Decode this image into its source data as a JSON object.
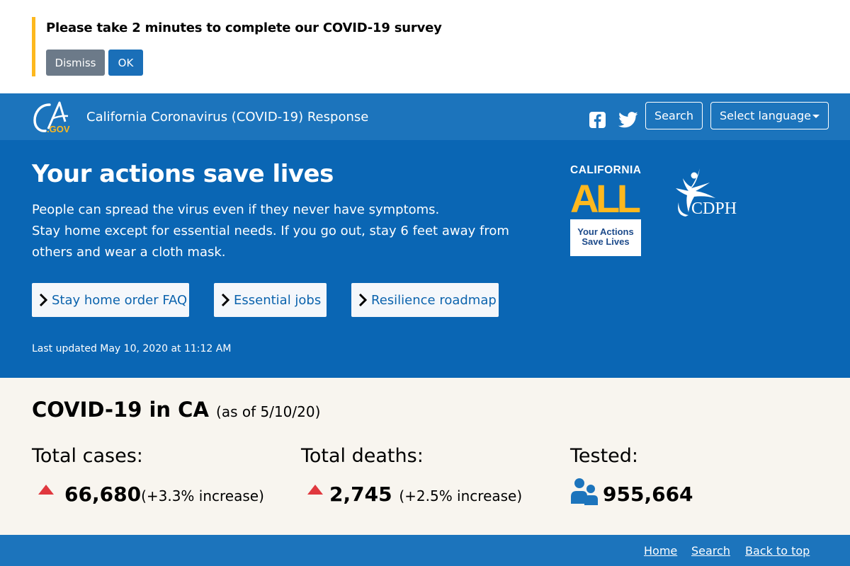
{
  "survey": {
    "message": "Please take 2 minutes to complete our COVID-19 survey",
    "dismiss_label": "Dismiss",
    "ok_label": "OK"
  },
  "header": {
    "logo_text": "CA.GOV",
    "title": "California Coronavirus (COVID-19) Response",
    "search_label": "Search",
    "language_label": "Select language",
    "icons": [
      "facebook-icon",
      "twitter-icon"
    ]
  },
  "hero": {
    "title": "Your actions save lives",
    "line1": "People can spread the virus even if they never have symptoms.",
    "line2": "Stay home except for essential needs. If you go out, stay 6 feet away from others and wear a cloth mask.",
    "links": [
      {
        "label": "Stay home order FAQ"
      },
      {
        "label": "Essential jobs"
      },
      {
        "label": "Resilience roadmap"
      }
    ],
    "updated": "Last updated May 10, 2020 at 11:12 AM",
    "badge": {
      "top": "CALIFORNIA",
      "big": "ALL",
      "sub1": "Your Actions",
      "sub2": "Save Lives"
    },
    "agency_logo": "CDPH"
  },
  "stats": {
    "title": "COVID-19 in CA",
    "as_of": "(as of 5/10/20)",
    "cases": {
      "label": "Total cases:",
      "value": "66,680",
      "note": "(+3.3% increase)"
    },
    "deaths": {
      "label": "Total deaths:",
      "value": "2,745",
      "note": "(+2.5% increase)"
    },
    "tested": {
      "label": "Tested:",
      "value": "955,664"
    }
  },
  "footer": {
    "links": [
      {
        "label": "Home"
      },
      {
        "label": "Search"
      },
      {
        "label": "Back to top"
      }
    ]
  },
  "colors": {
    "header_blue": "#1c74bc",
    "hero_blue": "#0a66b4",
    "survey_accent": "#fdb81e",
    "increase_red": "#e0383e",
    "stats_bg": "#f8f5ef"
  }
}
